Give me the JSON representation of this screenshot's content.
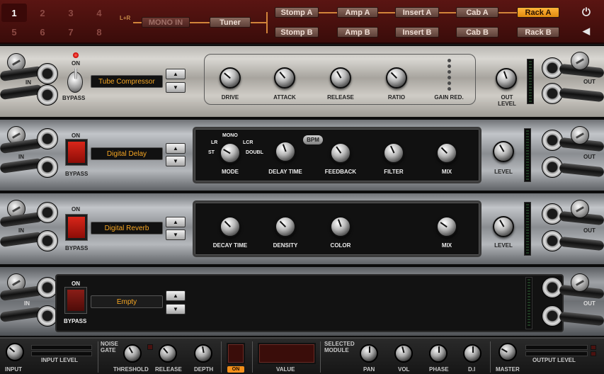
{
  "presets": [
    "1",
    "2",
    "3",
    "4",
    "5",
    "6",
    "7",
    "8"
  ],
  "active_preset": "1",
  "signal_chain": {
    "lr_label": "L+R",
    "mono_in": "MONO IN",
    "tuner": "Tuner",
    "stomp_a": "Stomp A",
    "stomp_b": "Stomp B",
    "amp_a": "Amp A",
    "amp_b": "Amp B",
    "insert_a": "Insert A",
    "insert_b": "Insert B",
    "cab_a": "Cab A",
    "cab_b": "Cab B",
    "rack_a": "Rack A",
    "rack_b": "Rack B"
  },
  "top_icons": {
    "power": "power-icon",
    "speaker": "speaker-icon"
  },
  "io": {
    "in": "IN",
    "out": "OUT"
  },
  "racks": [
    {
      "name": "Tube Compressor",
      "on_label": "ON",
      "bypass_label": "BYPASS",
      "controls": [
        "DRIVE",
        "ATTACK",
        "RELEASE",
        "RATIO"
      ],
      "gain_reduction": "GAIN RED.",
      "out_level": "OUT LEVEL"
    },
    {
      "name": "Digital Delay",
      "on_label": "ON",
      "bypass_label": "BYPASS",
      "mode_options": {
        "mono": "MONO",
        "lr": "LR",
        "lcr": "LCR",
        "st": "ST",
        "doubl": "DOUBL"
      },
      "bpm": "BPM",
      "controls": [
        "MODE",
        "DELAY TIME",
        "FEEDBACK",
        "FILTER",
        "MIX"
      ],
      "level": "LEVEL"
    },
    {
      "name": "Digital Reverb",
      "on_label": "ON",
      "bypass_label": "BYPASS",
      "controls": [
        "DECAY TIME",
        "DENSITY",
        "COLOR",
        "MIX"
      ],
      "level": "LEVEL"
    },
    {
      "name": "Empty",
      "on_label": "ON",
      "bypass_label": "BYPASS"
    }
  ],
  "bottom": {
    "input": "INPUT",
    "input_level": "INPUT LEVEL",
    "noise_gate": "NOISE GATE",
    "threshold": "THRESHOLD",
    "release": "RELEASE",
    "depth": "DEPTH",
    "on": "ON",
    "value": "VALUE",
    "selected_module": "SELECTED MODULE",
    "pan": "PAN",
    "vol": "VOL",
    "phase": "PHASE",
    "di": "D.I",
    "master": "MASTER",
    "output_level": "OUTPUT LEVEL"
  }
}
